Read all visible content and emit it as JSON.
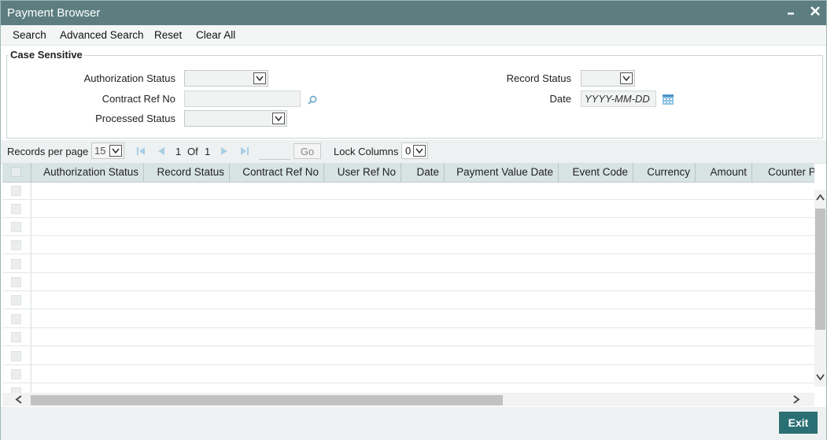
{
  "window": {
    "title": "Payment Browser"
  },
  "menu": {
    "search": "Search",
    "advanced_search": "Advanced Search",
    "reset": "Reset",
    "clear_all": "Clear All"
  },
  "criteria": {
    "legend": "Case Sensitive",
    "authorization_status_label": "Authorization Status",
    "contract_ref_no_label": "Contract Ref No",
    "processed_status_label": "Processed Status",
    "record_status_label": "Record Status",
    "date_label": "Date",
    "date_placeholder": "YYYY-MM-DD"
  },
  "pager": {
    "records_per_page_label": "Records per page",
    "records_per_page_value": "15",
    "current_page": "1",
    "of_label": "Of",
    "total_pages": "1",
    "go_label": "Go",
    "lock_columns_label": "Lock Columns",
    "lock_columns_value": "0"
  },
  "table": {
    "columns": [
      "Authorization Status",
      "Record Status",
      "Contract Ref No",
      "User Ref No",
      "Date",
      "Payment Value Date",
      "Event Code",
      "Currency",
      "Amount",
      "Counter P"
    ]
  },
  "footer": {
    "exit_label": "Exit"
  },
  "colors": {
    "titlebar": "#5c7e81",
    "exit_button": "#2a6f73",
    "grid_header": "#d8e3e3"
  },
  "icons": [
    "minimize-icon",
    "close-icon",
    "search-icon",
    "calendar-icon",
    "first-page-icon",
    "prev-page-icon",
    "next-page-icon",
    "last-page-icon",
    "chevron-down-icon",
    "scroll-up-icon",
    "scroll-down-icon",
    "scroll-left-icon",
    "scroll-right-icon"
  ]
}
